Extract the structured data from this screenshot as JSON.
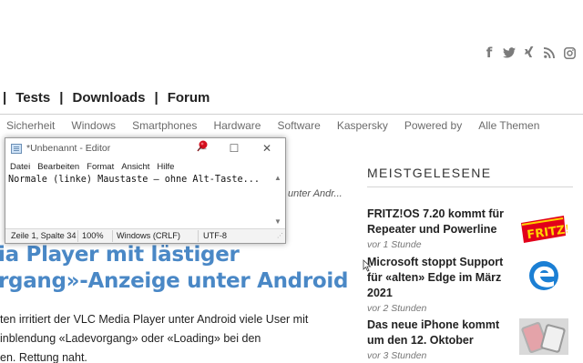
{
  "social": {
    "facebook_icon": "f",
    "twitter_icon": "🐦",
    "xing_icon": "✕",
    "rss_icon": "rss",
    "instagram_icon": "◎"
  },
  "mainnav": {
    "sep": "|",
    "items": [
      "Tests",
      "Downloads",
      "Forum"
    ]
  },
  "subnav": {
    "items": [
      "Sicherheit",
      "Windows",
      "Smartphones",
      "Hardware",
      "Software",
      "Kaspersky",
      "Powered by",
      "Alle Themen"
    ]
  },
  "teaser": {
    "meta": "unter Andr...",
    "title_lines": [
      "ia Player mit lästiger",
      "rgang»-Anzeige unter Android"
    ],
    "body_lines": [
      "ten irritiert der VLC Media Player unter Android viele User mit",
      "inblendung «Ladevorgang» oder «Loading» bei den",
      "en. Rettung naht."
    ]
  },
  "sidebar": {
    "heading": "MEISTGELESENE",
    "items": [
      {
        "title": "FRITZ!OS 7.20 kommt für Repeater und Powerline",
        "time": "vor 1 Stunde",
        "thumb": "fritz-logo"
      },
      {
        "title": "Microsoft stoppt Support für «alten» Edge im März 2021",
        "time": "vor 2 Stunden",
        "thumb": "edge-logo"
      },
      {
        "title": "Das neue iPhone kommt um den 12. Oktober",
        "time": "vor 3 Stunden",
        "thumb": "iphone-photo"
      }
    ],
    "fritz_text": "FRITZ!"
  },
  "editor": {
    "title": "*Unbenannt - Editor",
    "menu": [
      "Datei",
      "Bearbeiten",
      "Format",
      "Ansicht",
      "Hilfe"
    ],
    "content": "Normale (linke) Maustaste – ohne Alt-Taste...",
    "status": {
      "position": "Zeile 1, Spalte 34",
      "zoom": "100%",
      "line_ending": "Windows (CRLF)",
      "encoding": "UTF-8"
    },
    "minimize_glyph": "—",
    "maximize_glyph": "☐",
    "close_glyph": "✕"
  },
  "colors": {
    "title_blue": "#4a88c6",
    "fritz_red": "#e2001a",
    "edge_blue": "#1b7fd4"
  }
}
